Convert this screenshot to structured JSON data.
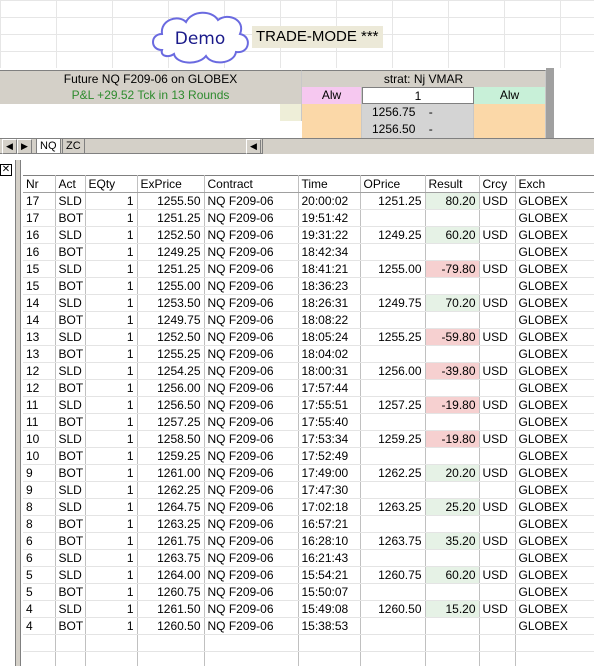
{
  "header": {
    "demo_label": "Demo",
    "mode_label": "TRADE-MODE ***"
  },
  "panel": {
    "instrument": "Future NQ  F209-06 on GLOBEX",
    "strategy": "strat: Nj VMAR",
    "pnl": "P&L +29.52 Tck in 13 Rounds",
    "alw_left": "Alw",
    "quantity": "1",
    "alw_right": "Alw",
    "price_1": "1256.75",
    "price_1_dash": "-",
    "price_2": "1256.50",
    "price_2_dash": "-"
  },
  "tabs": [
    {
      "label": "NQ"
    },
    {
      "label": "ZC"
    }
  ],
  "colors": {
    "pnl_green": "#2e8b2e",
    "alw_left_bg": "#f6c8f0",
    "alw_right_bg": "#c8f0d8",
    "order_bg": "#fbd8a8",
    "positive_result_bg": "#e6f2e6",
    "negative_result_bg": "#f6d0d0"
  },
  "table": {
    "columns": [
      "Nr",
      "Act",
      "EQty",
      "ExPrice",
      "Contract",
      "Time",
      "OPrice",
      "Result",
      "Crcy",
      "Exch"
    ],
    "rows": [
      [
        "17",
        "SLD",
        "1",
        "1255.50",
        "NQ  F209-06",
        "20:00:02",
        "1251.25",
        "80.20",
        "USD",
        "GLOBEX"
      ],
      [
        "17",
        "BOT",
        "1",
        "1251.25",
        "NQ  F209-06",
        "19:51:42",
        "",
        "",
        "",
        "GLOBEX"
      ],
      [
        "16",
        "SLD",
        "1",
        "1252.50",
        "NQ  F209-06",
        "19:31:22",
        "1249.25",
        "60.20",
        "USD",
        "GLOBEX"
      ],
      [
        "16",
        "BOT",
        "1",
        "1249.25",
        "NQ  F209-06",
        "18:42:34",
        "",
        "",
        "",
        "GLOBEX"
      ],
      [
        "15",
        "SLD",
        "1",
        "1251.25",
        "NQ  F209-06",
        "18:41:21",
        "1255.00",
        "-79.80",
        "USD",
        "GLOBEX"
      ],
      [
        "15",
        "BOT",
        "1",
        "1255.00",
        "NQ  F209-06",
        "18:36:23",
        "",
        "",
        "",
        "GLOBEX"
      ],
      [
        "14",
        "SLD",
        "1",
        "1253.50",
        "NQ  F209-06",
        "18:26:31",
        "1249.75",
        "70.20",
        "USD",
        "GLOBEX"
      ],
      [
        "14",
        "BOT",
        "1",
        "1249.75",
        "NQ  F209-06",
        "18:08:22",
        "",
        "",
        "",
        "GLOBEX"
      ],
      [
        "13",
        "SLD",
        "1",
        "1252.50",
        "NQ  F209-06",
        "18:05:24",
        "1255.25",
        "-59.80",
        "USD",
        "GLOBEX"
      ],
      [
        "13",
        "BOT",
        "1",
        "1255.25",
        "NQ  F209-06",
        "18:04:02",
        "",
        "",
        "",
        "GLOBEX"
      ],
      [
        "12",
        "SLD",
        "1",
        "1254.25",
        "NQ  F209-06",
        "18:00:31",
        "1256.00",
        "-39.80",
        "USD",
        "GLOBEX"
      ],
      [
        "12",
        "BOT",
        "1",
        "1256.00",
        "NQ  F209-06",
        "17:57:44",
        "",
        "",
        "",
        "GLOBEX"
      ],
      [
        "11",
        "SLD",
        "1",
        "1256.50",
        "NQ  F209-06",
        "17:55:51",
        "1257.25",
        "-19.80",
        "USD",
        "GLOBEX"
      ],
      [
        "11",
        "BOT",
        "1",
        "1257.25",
        "NQ  F209-06",
        "17:55:40",
        "",
        "",
        "",
        "GLOBEX"
      ],
      [
        "10",
        "SLD",
        "1",
        "1258.50",
        "NQ  F209-06",
        "17:53:34",
        "1259.25",
        "-19.80",
        "USD",
        "GLOBEX"
      ],
      [
        "10",
        "BOT",
        "1",
        "1259.25",
        "NQ  F209-06",
        "17:52:49",
        "",
        "",
        "",
        "GLOBEX"
      ],
      [
        "9",
        "BOT",
        "1",
        "1261.00",
        "NQ  F209-06",
        "17:49:00",
        "1262.25",
        "20.20",
        "USD",
        "GLOBEX"
      ],
      [
        "9",
        "SLD",
        "1",
        "1262.25",
        "NQ  F209-06",
        "17:47:30",
        "",
        "",
        "",
        "GLOBEX"
      ],
      [
        "8",
        "SLD",
        "1",
        "1264.75",
        "NQ  F209-06",
        "17:02:18",
        "1263.25",
        "25.20",
        "USD",
        "GLOBEX"
      ],
      [
        "8",
        "BOT",
        "1",
        "1263.25",
        "NQ  F209-06",
        "16:57:21",
        "",
        "",
        "",
        "GLOBEX"
      ],
      [
        "6",
        "BOT",
        "1",
        "1261.75",
        "NQ  F209-06",
        "16:28:10",
        "1263.75",
        "35.20",
        "USD",
        "GLOBEX"
      ],
      [
        "6",
        "SLD",
        "1",
        "1263.75",
        "NQ  F209-06",
        "16:21:43",
        "",
        "",
        "",
        "GLOBEX"
      ],
      [
        "5",
        "SLD",
        "1",
        "1264.00",
        "NQ  F209-06",
        "15:54:21",
        "1260.75",
        "60.20",
        "USD",
        "GLOBEX"
      ],
      [
        "5",
        "BOT",
        "1",
        "1260.75",
        "NQ  F209-06",
        "15:50:07",
        "",
        "",
        "",
        "GLOBEX"
      ],
      [
        "4",
        "SLD",
        "1",
        "1261.50",
        "NQ  F209-06",
        "15:49:08",
        "1260.50",
        "15.20",
        "USD",
        "GLOBEX"
      ],
      [
        "4",
        "BOT",
        "1",
        "1260.50",
        "NQ  F209-06",
        "15:38:53",
        "",
        "",
        "",
        "GLOBEX"
      ]
    ]
  }
}
